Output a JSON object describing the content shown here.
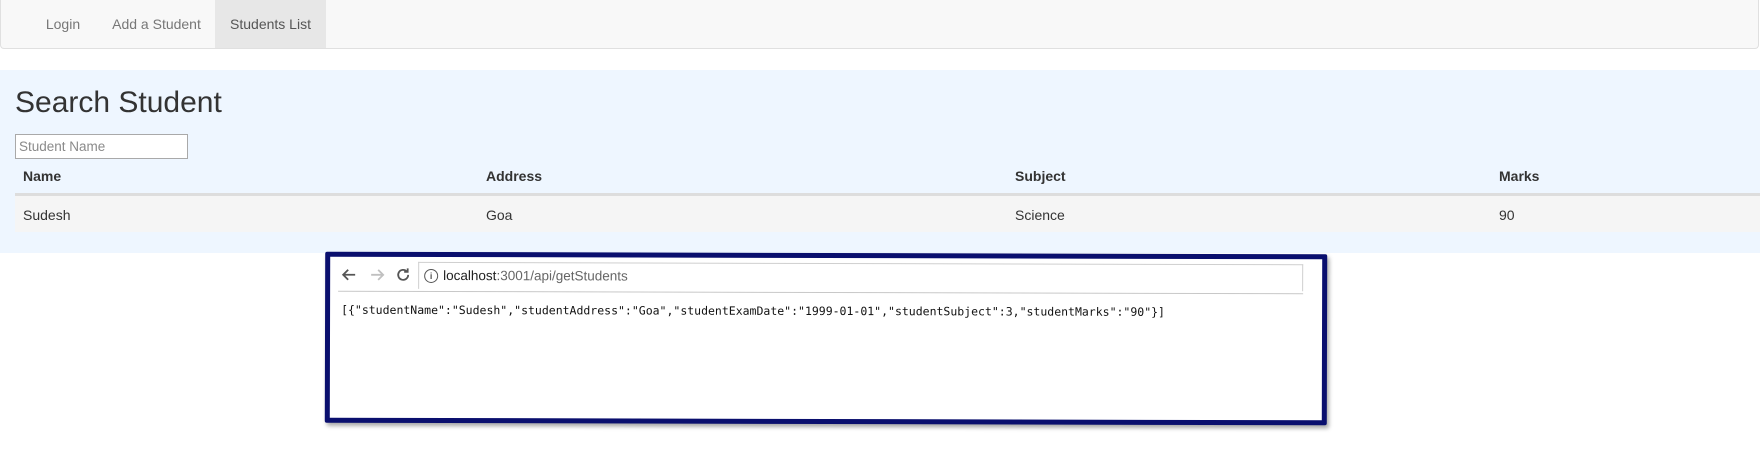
{
  "nav": {
    "items": [
      {
        "label": "Login",
        "active": false
      },
      {
        "label": "Add a Student",
        "active": false
      },
      {
        "label": "Students List",
        "active": true
      }
    ]
  },
  "page": {
    "title": "Search Student",
    "search": {
      "placeholder": "Student Name",
      "value": ""
    }
  },
  "table": {
    "columns": [
      "Name",
      "Address",
      "Subject",
      "Marks"
    ],
    "rows": [
      [
        "Sudesh",
        "Goa",
        "Science",
        "90"
      ]
    ]
  },
  "browser": {
    "icons": [
      "back-arrow-icon",
      "forward-arrow-icon",
      "reload-icon",
      "info-icon"
    ],
    "url_host": "localhost",
    "url_path": ":3001/api/getStudents",
    "response_text": "[{\"studentName\":\"Sudesh\",\"studentAddress\":\"Goa\",\"studentExamDate\":\"1999-01-01\",\"studentSubject\":3,\"studentMarks\":\"90\"}]",
    "frame_color": "#0a0f6e"
  },
  "colors": {
    "jumbotron_bg": "#eef6ff",
    "navbar_bg": "#f8f8f8",
    "active_nav_bg": "#e7e7e7"
  }
}
